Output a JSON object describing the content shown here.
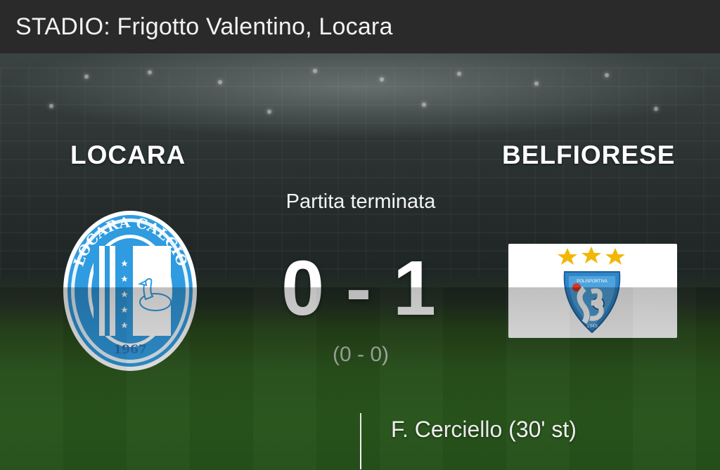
{
  "header": {
    "stadium": "STADIO: Frigotto Valentino, Locara"
  },
  "match": {
    "home_team": "LOCARA",
    "away_team": "BELFIORESE",
    "status": "Partita terminata",
    "score": "0 - 1",
    "halftime_score": "(0 - 0)",
    "scorers": {
      "away": [
        "F. Cerciello (30' st)"
      ]
    }
  },
  "logos": {
    "home": {
      "icon": "locara-calcio-crest",
      "text_top": "LOCARA CALCIO",
      "year": "1967",
      "color": "#2f9be0"
    },
    "away": {
      "icon": "belfiorese-crest",
      "color": "#2f86c9",
      "stars_color": "#f2b705"
    }
  }
}
